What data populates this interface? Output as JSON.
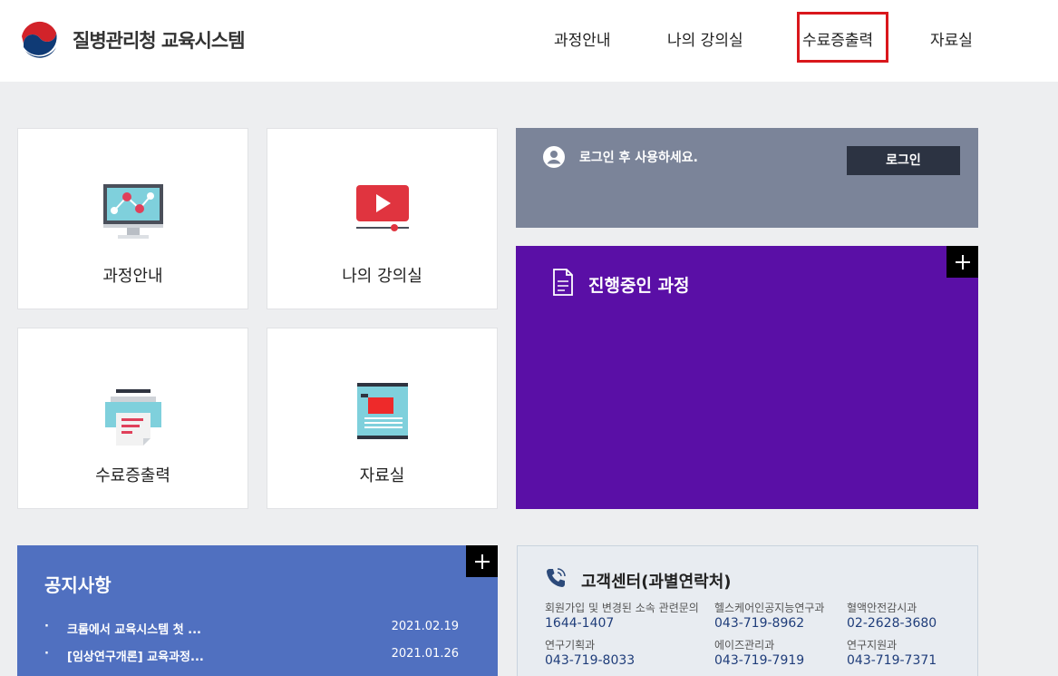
{
  "header": {
    "logo_text": "질병관리청 교육시스템",
    "nav": [
      {
        "label": "과정안내"
      },
      {
        "label": "나의 강의실"
      },
      {
        "label": "수료증출력"
      },
      {
        "label": "자료실"
      }
    ]
  },
  "tiles": [
    {
      "label": "과정안내",
      "icon": "monitor-chart-icon"
    },
    {
      "label": "나의 강의실",
      "icon": "video-play-icon"
    },
    {
      "label": "수료증출력",
      "icon": "printer-icon"
    },
    {
      "label": "자료실",
      "icon": "folder-book-icon"
    }
  ],
  "login": {
    "message": "로그인 후 사용하세요.",
    "button_label": "로그인"
  },
  "progress": {
    "title": "진행중인 과정"
  },
  "notice": {
    "title": "공지사항",
    "items": [
      {
        "bullet": "·",
        "text": "크롬에서 교육시스템 첫 ...",
        "date": "2021.02.19"
      },
      {
        "bullet": "·",
        "text": "[임상연구개론] 교육과정...",
        "date": "2021.01.26"
      }
    ]
  },
  "customer_center": {
    "title": "고객센터(과별연락처)",
    "contacts": [
      {
        "label": "회원가입 및 변경된 소속 관련문의",
        "phone": "1644-1407"
      },
      {
        "label": "헬스케어인공지능연구과",
        "phone": "043-719-8962"
      },
      {
        "label": "혈액안전감시과",
        "phone": "02-2628-3680"
      },
      {
        "label": "연구기획과",
        "phone": "043-719-8033"
      },
      {
        "label": "에이즈관리과",
        "phone": "043-719-7919"
      },
      {
        "label": "연구지원과",
        "phone": "043-719-7371"
      }
    ]
  },
  "colors": {
    "accent_purple": "#5a0fa6",
    "login_bg": "#7b8499",
    "notice_bg": "#5070c0",
    "highlight_red": "#d9171c"
  }
}
